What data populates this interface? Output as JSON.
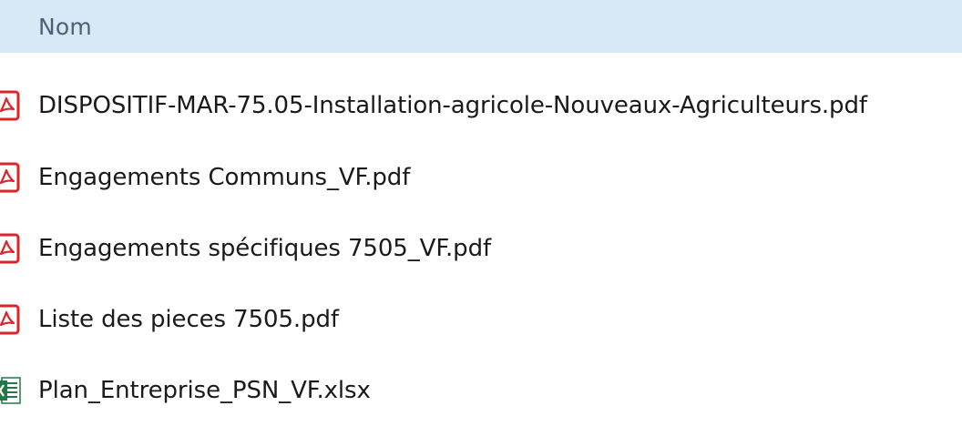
{
  "header": {
    "column_label": "Nom"
  },
  "files": [
    {
      "name": "DISPOSITIF-MAR-75.05-Installation-agricole-Nouveaux-Agriculteurs.pdf",
      "icon": "pdf-file-icon"
    },
    {
      "name": "Engagements Communs_VF.pdf",
      "icon": "pdf-file-icon"
    },
    {
      "name": "Engagements spécifiques 7505_VF.pdf",
      "icon": "pdf-file-icon"
    },
    {
      "name": "Liste des pieces 7505.pdf",
      "icon": "pdf-file-icon"
    },
    {
      "name": "Plan_Entreprise_PSN_VF.xlsx",
      "icon": "excel-file-icon"
    }
  ],
  "colors": {
    "header_bg": "#d9e8f7",
    "header_text": "#4d6076",
    "pdf_red": "#d9262b",
    "excel_green": "#1f7a45"
  }
}
